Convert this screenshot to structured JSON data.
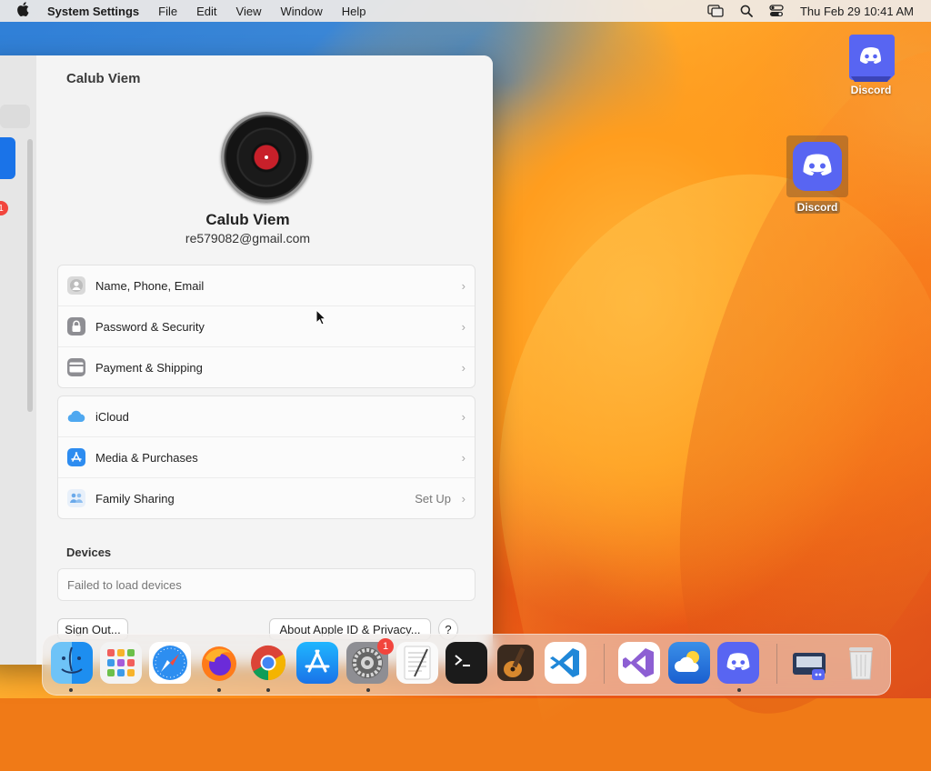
{
  "menubar": {
    "app_name": "System Settings",
    "items": [
      "File",
      "Edit",
      "View",
      "Window",
      "Help"
    ],
    "clock": "Thu Feb 29  10:41 AM"
  },
  "desktop": {
    "icons": [
      {
        "label": "Discord",
        "name": "discord-desktop-icon"
      },
      {
        "label": "Discord",
        "name": "discord-desktop-icon-selected"
      }
    ]
  },
  "window": {
    "title": "Calub Viem",
    "sidebar_badge": "1",
    "profile": {
      "name": "Calub Viem",
      "email": "re579082@gmail.com"
    },
    "account_group": [
      {
        "label": "Name, Phone, Email",
        "icon": "contact-icon"
      },
      {
        "label": "Password & Security",
        "icon": "lock-icon"
      },
      {
        "label": "Payment & Shipping",
        "icon": "card-icon"
      }
    ],
    "services_group": [
      {
        "label": "iCloud",
        "icon": "icloud-icon",
        "status": ""
      },
      {
        "label": "Media & Purchases",
        "icon": "app-store-icon",
        "status": ""
      },
      {
        "label": "Family Sharing",
        "icon": "family-icon",
        "status": "Set Up"
      }
    ],
    "devices": {
      "title": "Devices",
      "message": "Failed to load devices"
    },
    "buttons": {
      "sign_out": "Sign Out...",
      "about": "About Apple ID & Privacy...",
      "help": "?"
    }
  },
  "dock": {
    "apps": [
      "Finder",
      "Launchpad",
      "Safari",
      "Firefox",
      "Google Chrome",
      "App Store",
      "System Settings",
      "TextEdit",
      "Terminal",
      "GarageBand",
      "Visual Studio Code",
      "Visual Studio",
      "Weather",
      "Discord",
      "Downloads",
      "Trash"
    ],
    "settings_badge": "1"
  },
  "colors": {
    "accent": "#1a73e8",
    "discord": "#5865f2",
    "badge": "#f2453d"
  }
}
